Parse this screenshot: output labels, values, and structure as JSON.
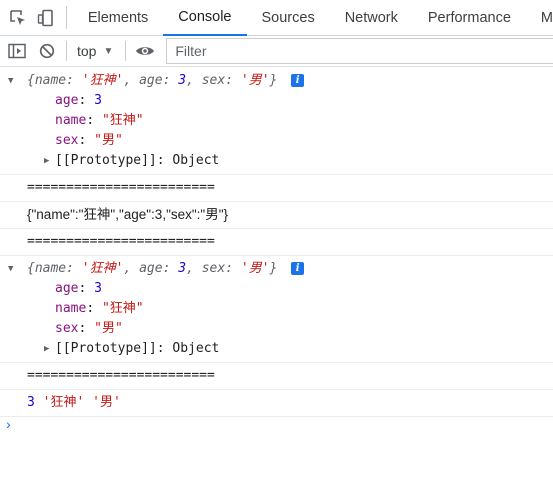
{
  "tabs": [
    "Elements",
    "Console",
    "Sources",
    "Network",
    "Performance",
    "M"
  ],
  "toolbar": {
    "context": "top",
    "filter_placeholder": "Filter"
  },
  "messages": {
    "obj1": {
      "summary_open": "{",
      "summary": {
        "k1": "name",
        "v1": "'狂神'",
        "k2": "age",
        "v2": "3",
        "k3": "sex",
        "v3": "'男'"
      },
      "summary_close": "}",
      "props": [
        {
          "key": "age",
          "value": "3"
        },
        {
          "key": "name",
          "value": "\"狂神\""
        },
        {
          "key": "sex",
          "value": "\"男\""
        }
      ],
      "proto_key": "[[Prototype]]",
      "proto_value": "Object"
    },
    "sep1": "========================",
    "json": "{\"name\":\"狂神\",\"age\":3,\"sex\":\"男\"}",
    "sep2": "========================",
    "obj2": {
      "summary_open": "{",
      "summary": {
        "k1": "name",
        "v1": "'狂神'",
        "k2": "age",
        "v2": "3",
        "k3": "sex",
        "v3": "'男'"
      },
      "summary_close": "}",
      "props": [
        {
          "key": "age",
          "value": "3"
        },
        {
          "key": "name",
          "value": "\"狂神\""
        },
        {
          "key": "sex",
          "value": "\"男\""
        }
      ],
      "proto_key": "[[Prototype]]",
      "proto_value": "Object"
    },
    "sep3": "========================",
    "last": {
      "num": "3",
      "s1": "'狂神'",
      "s2": "'男'"
    }
  },
  "colors": {
    "accent": "#1a73e8",
    "key": "#881280",
    "string": "#c41a16",
    "number": "#1c00cf"
  },
  "icons": [
    "inspect-element-icon",
    "device-toolbar-icon",
    "sidebar-toggle-icon",
    "clear-console-icon",
    "eye-icon",
    "chevron-right-icon",
    "triangle-down-icon",
    "triangle-right-icon",
    "info-icon"
  ]
}
